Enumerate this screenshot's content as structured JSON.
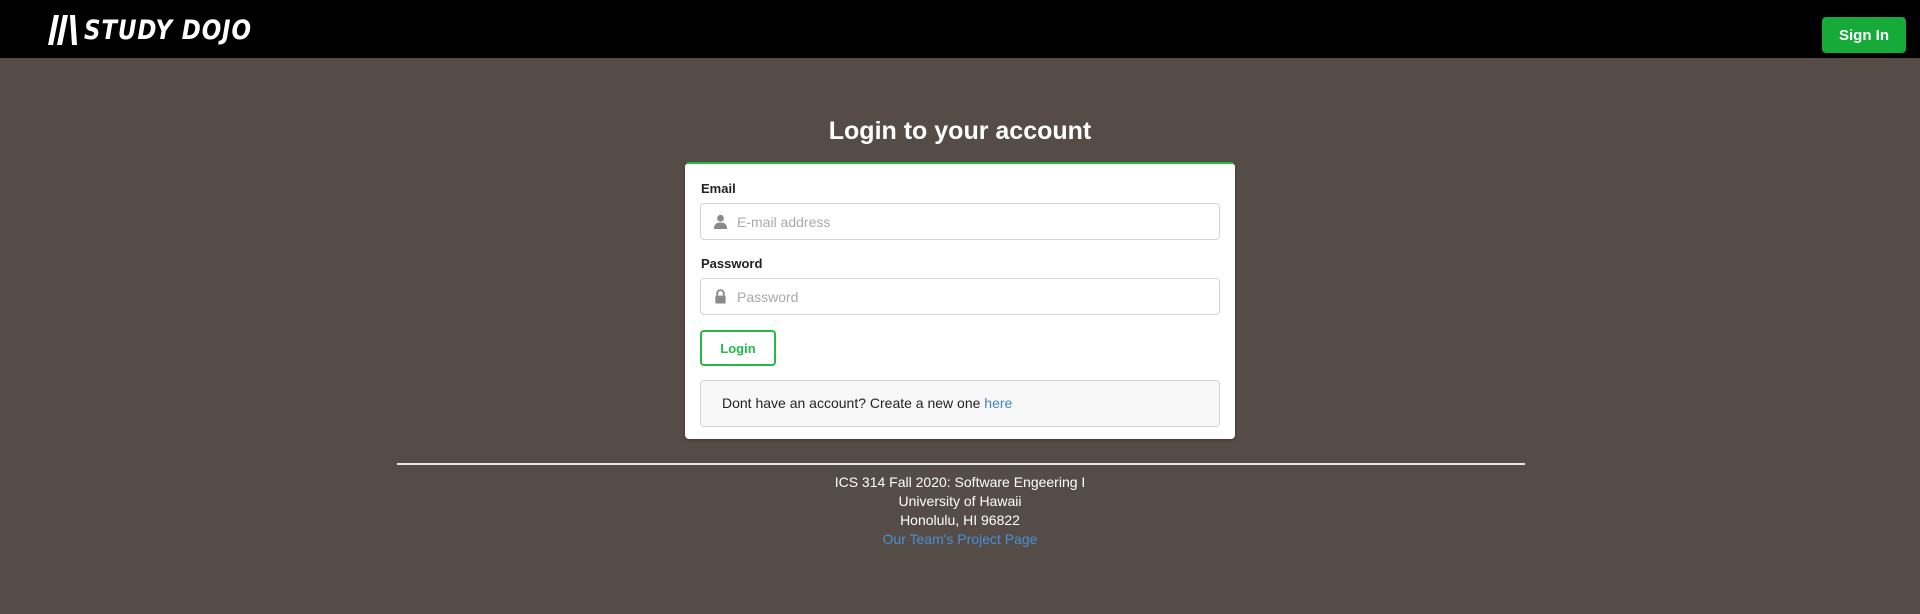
{
  "header": {
    "logo_text": "STUDY DOJO",
    "signin_label": "Sign In"
  },
  "login": {
    "title": "Login to your account",
    "email_label": "Email",
    "email_placeholder": "E-mail address",
    "email_value": "",
    "password_label": "Password",
    "password_placeholder": "Password",
    "password_value": "",
    "login_label": "Login",
    "signup_prefix": "Dont have an account? Create a new one ",
    "signup_link": "here"
  },
  "footer": {
    "line1": "ICS 314 Fall 2020: Software Engeering I",
    "line2": "University of Hawaii",
    "line3": "Honolulu, HI 96822",
    "project_link": "Our Team's Project Page"
  },
  "colors": {
    "background": "#554c47",
    "topbar": "#000000",
    "accent_green": "#21ba45",
    "link_blue": "#4183c4"
  },
  "icons": {
    "email": "user-icon",
    "password": "lock-icon"
  }
}
